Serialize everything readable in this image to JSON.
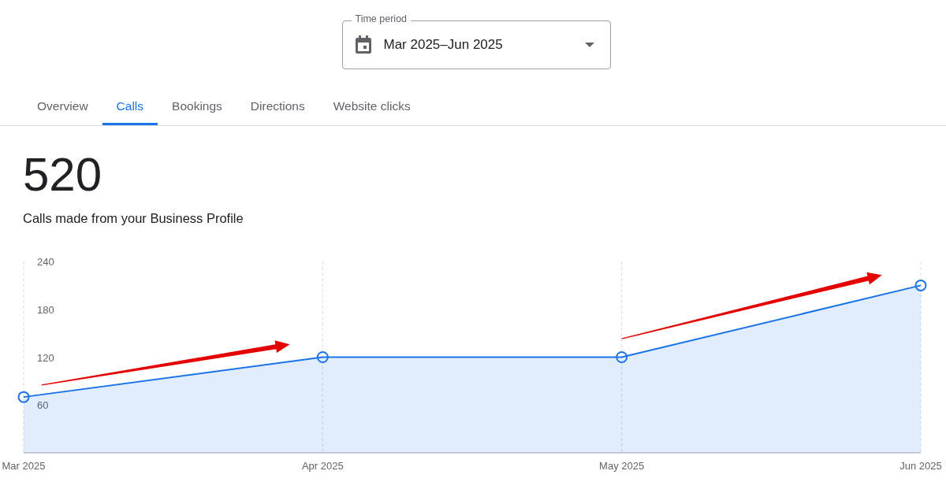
{
  "time_period": {
    "label": "Time period",
    "value": "Mar 2025–Jun 2025"
  },
  "tabs": [
    {
      "label": "Overview",
      "selected": false
    },
    {
      "label": "Calls",
      "selected": true
    },
    {
      "label": "Bookings",
      "selected": false
    },
    {
      "label": "Directions",
      "selected": false
    },
    {
      "label": "Website clicks",
      "selected": false
    }
  ],
  "metric": {
    "value": "520",
    "caption": "Calls made from your Business Profile"
  },
  "chart": {
    "chart_data": {
      "type": "area",
      "x": [
        "Mar 2025",
        "Apr 2025",
        "May 2025",
        "Jun 2025"
      ],
      "series": [
        {
          "color": "#1a73e8",
          "values": [
            70,
            120,
            120,
            210
          ]
        }
      ],
      "ylim": [
        0,
        240
      ],
      "yticks": [
        60,
        120,
        180,
        240
      ]
    }
  }
}
